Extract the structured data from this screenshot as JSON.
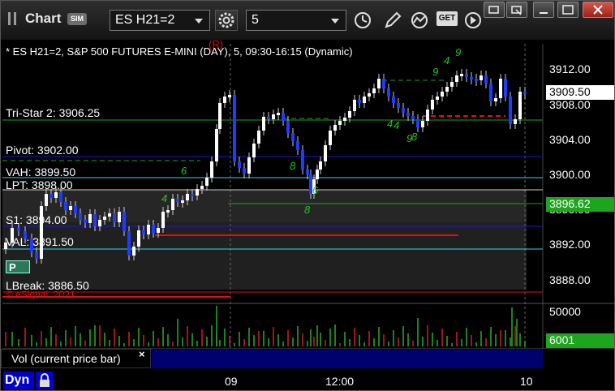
{
  "app": {
    "title": "Chart",
    "sim_badge": "SIM",
    "symbol": "ES H21=2",
    "interval": "5",
    "icons": [
      "gear-icon",
      "clock-icon",
      "pencil-icon",
      "study-icon",
      "get-icon",
      "play-icon"
    ],
    "get_label": "GET"
  },
  "window": {
    "buttons": [
      "restore-icon",
      "minimize-icon",
      "maximize-icon",
      "close-icon"
    ]
  },
  "chart": {
    "header": "* ES H21=2, S&P 500 FUTURES E-MINI (DAY), 5, 09:30-16:15 (Dynamic)",
    "copyright": "© eSignal, 2021",
    "price_labels": [
      "3912.00",
      "3908.00",
      "3904.00",
      "3900.00",
      "3896.00",
      "3892.00",
      "3888.00"
    ],
    "current_price": "3909.50",
    "green_price": "3896.62",
    "vol_labels": [
      "50000"
    ],
    "vol_current": "6001",
    "time_labels": [
      "09",
      "12:00",
      "10"
    ],
    "level_labels": {
      "tristar": "Tri-Star 2: 3906.25",
      "pivot": "Pivot: 3902.00",
      "vah": "VAH: 3899.50",
      "lpt": "LPT: 3898.00",
      "s1": "S1: 3894.00",
      "val": "VAL: 3891.50",
      "lbreak": "LBreak: 3886.50"
    },
    "legend": "Vol (current price bar)",
    "legend_close": "×",
    "colors": {
      "up": "#ffffff",
      "down": "#1e3cff",
      "green_level": "#1fa01f",
      "blue_level": "#1919d8",
      "red_level": "#e01010",
      "cyan_level": "#2fd7e8",
      "seq_green": "#22c822"
    },
    "seq_labels": [
      "9",
      "4",
      "8",
      "9",
      "6",
      "4",
      "8",
      "6",
      "9",
      "4",
      "8",
      "4"
    ]
  },
  "bottom": {
    "dyn": "Dyn"
  }
}
